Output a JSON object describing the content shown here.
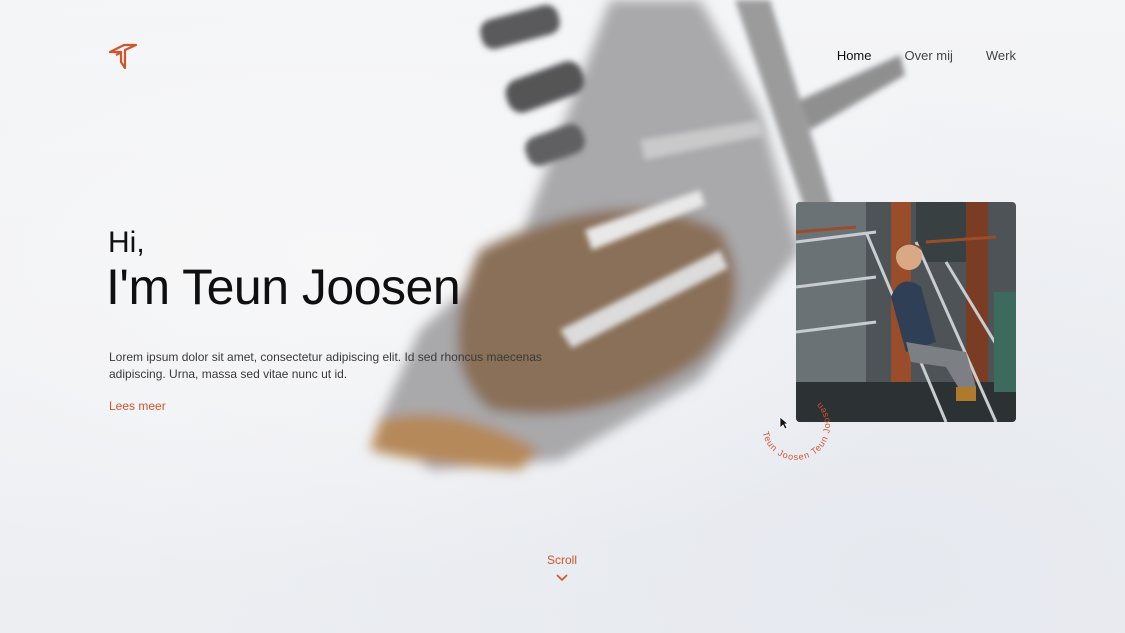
{
  "nav": {
    "items": [
      {
        "label": "Home",
        "active": true
      },
      {
        "label": "Over mij",
        "active": false
      },
      {
        "label": "Werk",
        "active": false
      }
    ]
  },
  "hero": {
    "greeting": "Hi,",
    "name": "I'm Teun Joosen",
    "intro": "Lorem ipsum dolor sit amet, consectetur adipiscing elit. Id sed rhoncus maecenas adipiscing. Urna, massa sed vitae nunc ut id.",
    "cta": "Lees meer"
  },
  "badge": {
    "text": "Teun Joosen Teun Joosen"
  },
  "scroll": {
    "label": "Scroll",
    "icon": "chevron-down-icon"
  },
  "colors": {
    "accent": "#d0552d",
    "text": "#111111",
    "background": "#eef0f3"
  }
}
